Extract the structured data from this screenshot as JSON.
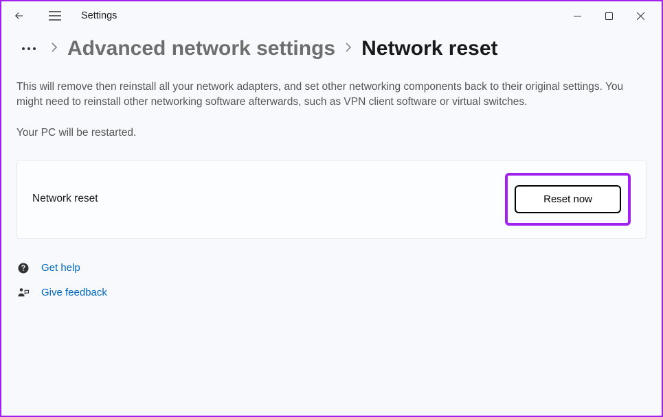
{
  "titlebar": {
    "app_title": "Settings"
  },
  "breadcrumb": {
    "parent": "Advanced network settings",
    "current": "Network reset"
  },
  "main": {
    "description": "This will remove then reinstall all your network adapters, and set other networking components back to their original settings. You might need to reinstall other networking software afterwards, such as VPN client software or virtual switches.",
    "restart_note": "Your PC will be restarted.",
    "card_label": "Network reset",
    "reset_button": "Reset now"
  },
  "links": {
    "help": "Get help",
    "feedback": "Give feedback"
  }
}
